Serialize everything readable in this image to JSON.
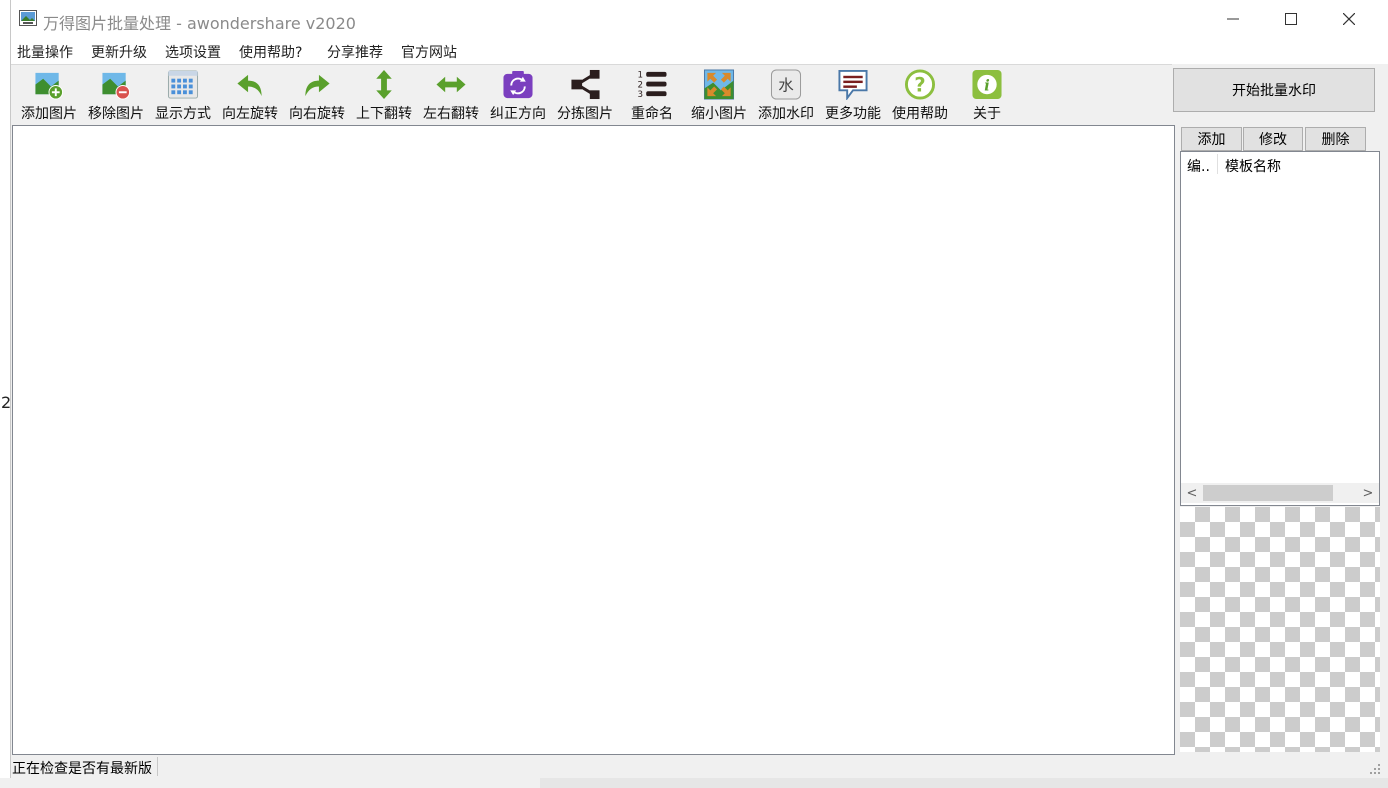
{
  "window": {
    "title": "万得图片批量处理 - awondershare v2020",
    "controls": {
      "minimize": "—",
      "maximize": "☐",
      "close": "✕"
    }
  },
  "menu": [
    "批量操作",
    "更新升级",
    "选项设置",
    "使用帮助?",
    "分享推荐",
    "官方网站"
  ],
  "toolbar": [
    {
      "label": "添加图片",
      "icon": "add-image-icon"
    },
    {
      "label": "移除图片",
      "icon": "remove-image-icon"
    },
    {
      "label": "显示方式",
      "icon": "view-grid-icon"
    },
    {
      "label": "向左旋转",
      "icon": "rotate-left-icon"
    },
    {
      "label": "向右旋转",
      "icon": "rotate-right-icon"
    },
    {
      "label": "上下翻转",
      "icon": "flip-vertical-icon"
    },
    {
      "label": "左右翻转",
      "icon": "flip-horizontal-icon"
    },
    {
      "label": "纠正方向",
      "icon": "camera-rotate-icon"
    },
    {
      "label": "分拣图片",
      "icon": "share-sort-icon"
    },
    {
      "label": "重命名",
      "icon": "numbered-list-icon"
    },
    {
      "label": "缩小图片",
      "icon": "shrink-image-icon"
    },
    {
      "label": "添加水印",
      "icon": "watermark-icon"
    },
    {
      "label": "更多功能",
      "icon": "message-icon"
    },
    {
      "label": "使用帮助",
      "icon": "help-icon"
    },
    {
      "label": "关于",
      "icon": "info-icon"
    }
  ],
  "watermark_icon_char": "水",
  "start_button": "开始批量水印",
  "template_panel": {
    "add": "添加",
    "edit": "修改",
    "delete": "删除",
    "columns": [
      "编..",
      "模板名称"
    ]
  },
  "scroll": {
    "left": "<",
    "right": ">"
  },
  "status": "正在检查是否有最新版",
  "stray_digit": "2",
  "colors": {
    "accent_green": "#5aa02c",
    "purple": "#7b3fbf",
    "dark": "#2b1e1e"
  }
}
